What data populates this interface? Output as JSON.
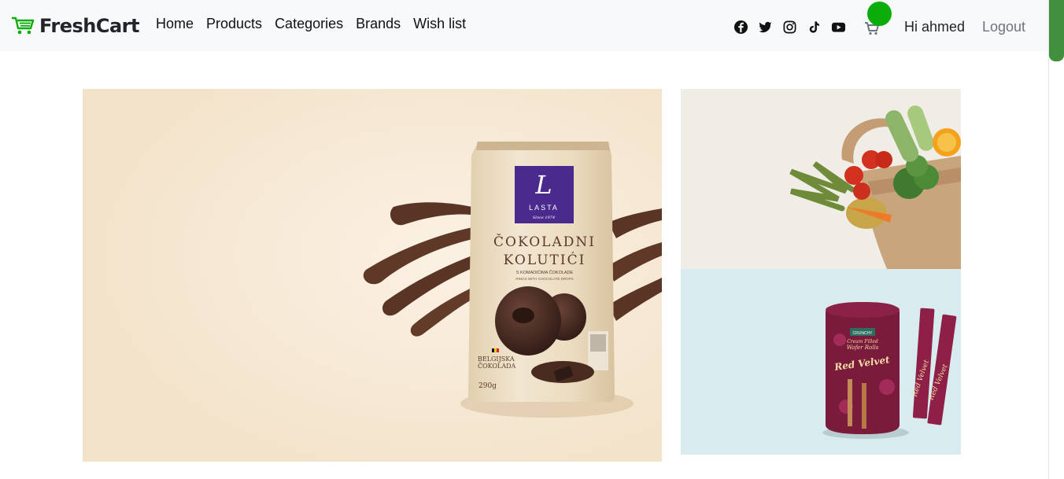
{
  "brand": {
    "name": "FreshCart",
    "accent": "#0aad0a"
  },
  "nav": {
    "links": [
      {
        "label": "Home"
      },
      {
        "label": "Products"
      },
      {
        "label": "Categories"
      },
      {
        "label": "Brands"
      },
      {
        "label": "Wish list"
      }
    ]
  },
  "social_icons": [
    "facebook-icon",
    "twitter-icon",
    "instagram-icon",
    "tiktok-icon",
    "youtube-icon"
  ],
  "user": {
    "greeting": "Hi ahmed",
    "logout_label": "Logout"
  },
  "slider": {
    "main_product": {
      "brand": "LASTA",
      "brand_tag": "Since 1974",
      "title_line1": "ČOKOLADNI",
      "title_line2": "KOLUTIĆI",
      "subtitle": "S KOMADIĆIMA ČOKOLADE",
      "subtitle2": "RINGS WITH CHOCOLATE DROPS",
      "origin_line1": "BELGIJSKA",
      "origin_line2": "ČOKOLADA",
      "weight": "290g"
    },
    "side_product": {
      "brand": "CRUNCHY",
      "line1": "Cream Filled",
      "line2": "Wafer Rolls",
      "flavor": "Red Velvet"
    }
  }
}
